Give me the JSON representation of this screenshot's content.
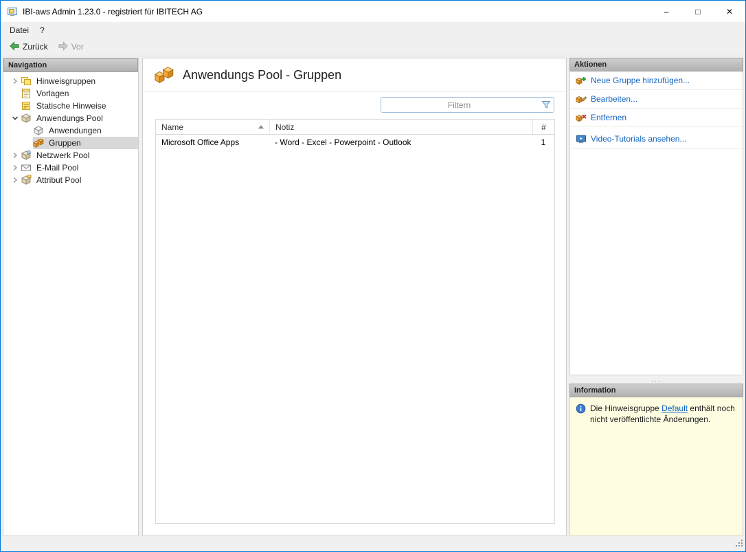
{
  "window": {
    "title": "IBI-aws Admin 1.23.0 - registriert für IBITECH AG",
    "controls": {
      "minimize": "–",
      "maximize": "□",
      "close": "✕"
    }
  },
  "menubar": {
    "items": [
      {
        "label": "Datei"
      },
      {
        "label": "?"
      }
    ]
  },
  "toolbar": {
    "back_label": "Zurück",
    "forward_label": "Vor"
  },
  "navigation": {
    "header": "Navigation",
    "items": [
      {
        "label": "Hinweisgruppen",
        "level": 0,
        "expander": "collapsed",
        "icon": "hint-groups"
      },
      {
        "label": "Vorlagen",
        "level": 0,
        "expander": "none",
        "icon": "templates"
      },
      {
        "label": "Statische Hinweise",
        "level": 0,
        "expander": "none",
        "icon": "static-hints"
      },
      {
        "label": "Anwendungs Pool",
        "level": 0,
        "expander": "expanded",
        "icon": "application-pool"
      },
      {
        "label": "Anwendungen",
        "level": 1,
        "expander": "none",
        "icon": "applications"
      },
      {
        "label": "Gruppen",
        "level": 1,
        "expander": "none",
        "icon": "groups",
        "selected": true
      },
      {
        "label": "Netzwerk Pool",
        "level": 0,
        "expander": "collapsed",
        "icon": "network-pool"
      },
      {
        "label": "E-Mail Pool",
        "level": 0,
        "expander": "collapsed",
        "icon": "email-pool"
      },
      {
        "label": "Attribut Pool",
        "level": 0,
        "expander": "collapsed",
        "icon": "attribute-pool"
      }
    ]
  },
  "main": {
    "title": "Anwendungs Pool - Gruppen",
    "filter_placeholder": "Filtern",
    "table": {
      "columns": {
        "name": "Name",
        "notiz": "Notiz",
        "count": "#"
      },
      "sort": {
        "column": "Name",
        "direction": "ascending"
      },
      "rows": [
        {
          "name": "Microsoft Office Apps",
          "notiz": "- Word - Excel - Powerpoint - Outlook",
          "count": "1"
        }
      ]
    }
  },
  "actions": {
    "header": "Aktionen",
    "items": [
      {
        "label": "Neue Gruppe hinzufügen...",
        "icon": "add-group"
      },
      {
        "label": "Bearbeiten...",
        "icon": "edit-group"
      },
      {
        "label": "Entfernen",
        "icon": "remove-group"
      },
      {
        "label": "Video-Tutorials ansehen...",
        "icon": "video-tutorials"
      }
    ]
  },
  "information": {
    "header": "Information",
    "text_before": "Die Hinweisgruppe ",
    "link": "Default",
    "text_after": " enthält noch nicht veröffentlichte Änderungen."
  },
  "colors": {
    "window_border": "#0079d8",
    "action_link": "#1566c0",
    "info_background": "#fffde1",
    "selection_background": "#d8d8d8"
  }
}
